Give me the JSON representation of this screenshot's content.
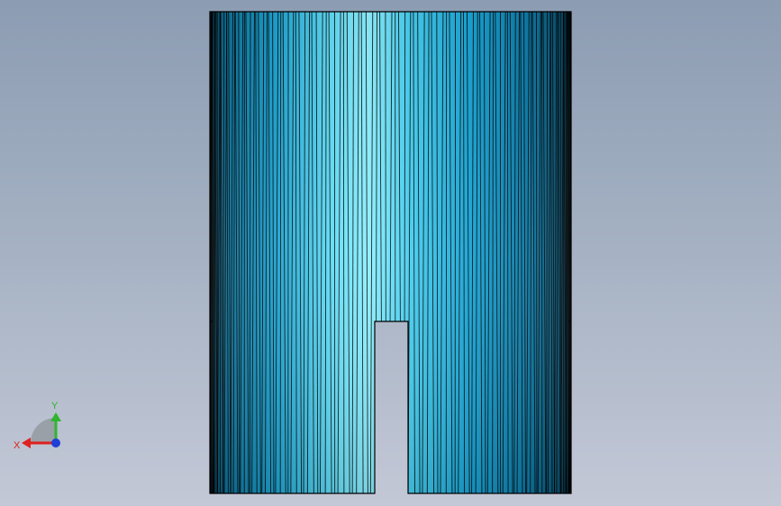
{
  "viewport": {
    "background_top": "#8c9cb2",
    "background_bottom": "#c3c8d6"
  },
  "model": {
    "shape": "cylinder-with-slot",
    "view": "front",
    "display_mode": "shaded-with-edges",
    "face_color": "#2fb8e6",
    "highlight_color": "#8ff0ff",
    "edge_color": "#000000"
  },
  "triad": {
    "x_label": "X",
    "y_label": "Y",
    "x_color": "#e0201e",
    "y_color": "#2fb52f",
    "z_color": "#1f3fd6"
  }
}
